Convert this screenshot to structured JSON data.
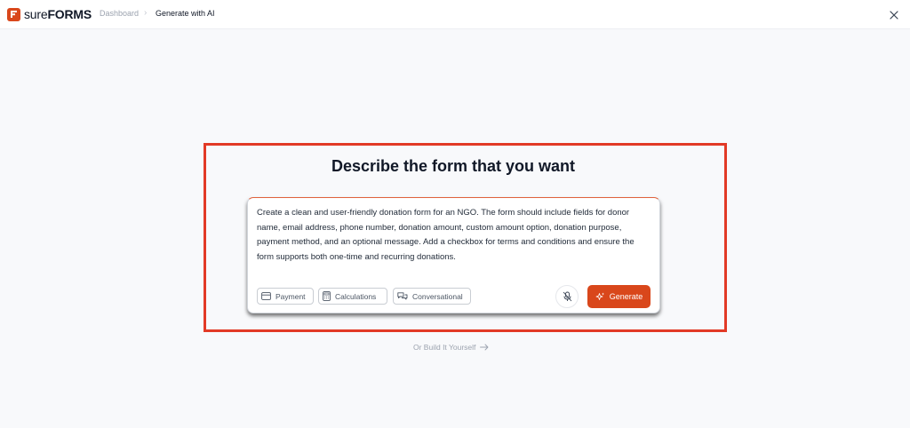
{
  "header": {
    "brand_part1": "sure",
    "brand_part2": "FORMS",
    "breadcrumb": [
      "Dashboard",
      "Generate with AI"
    ],
    "separator": "›"
  },
  "main": {
    "heading": "Describe the form that you want",
    "prompt_text": "Create a clean and user-friendly donation form for an NGO. The form should include fields for donor name, email address, phone number, donation amount, custom amount option, donation purpose, payment method, and an optional message. Add a checkbox for terms and conditions and ensure the form supports both one-time and recurring donations.",
    "chips": [
      {
        "label": "Payment",
        "icon": "credit-card-icon"
      },
      {
        "label": "Calculations",
        "icon": "calculator-icon"
      },
      {
        "label": "Conversational",
        "icon": "chat-bubbles-icon"
      }
    ],
    "generate_label": "Generate",
    "build_link": "Or Build It Yourself"
  },
  "colors": {
    "brand": "#d9471b",
    "highlight": "#e23a26"
  }
}
